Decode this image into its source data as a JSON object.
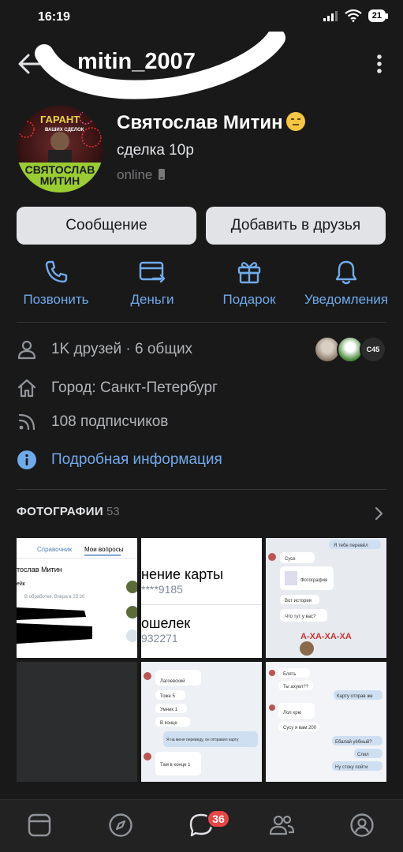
{
  "status_bar": {
    "time": "16:19",
    "battery": "21"
  },
  "header": {
    "username": "mitin_2007"
  },
  "profile": {
    "name": "Святослав Митин",
    "status": "сделка 10р",
    "online": "online",
    "avatar_text_top": "ГАРАНТ",
    "avatar_text_sub": "ВАШИХ СДЕЛОК",
    "avatar_text_name1": "СВЯТОСЛАВ",
    "avatar_text_name2": "МИТИН"
  },
  "buttons": {
    "message": "Сообщение",
    "add_friend": "Добавить в друзья"
  },
  "actions": [
    {
      "label": "Позвонить",
      "icon": "phone-icon"
    },
    {
      "label": "Деньги",
      "icon": "money-transfer-icon"
    },
    {
      "label": "Подарок",
      "icon": "gift-icon"
    },
    {
      "label": "Уведомления",
      "icon": "bell-icon"
    }
  ],
  "info": {
    "friends": "1K друзей · 6 общих",
    "city": "Город: Санкт-Петербург",
    "followers": "108 подписчиков",
    "details": "Подробная информация",
    "mini_avatar_text": "C45"
  },
  "photos": {
    "title": "ФОТОГРАФИИ",
    "count": "53",
    "t1": {
      "tab1": "Справочник",
      "tab2": "Мои вопросы",
      "name": "тослав Митин",
      "sub": "ейк",
      "note": "В обработке, Вчера в 23:20"
    },
    "t2": {
      "line1": "нение карты",
      "line2": "****9185",
      "line3": "ошелек",
      "line4": "932271"
    },
    "t3": {
      "m1": "Я тебе перевёл",
      "m2": "Сусе",
      "m3": "Фотография",
      "m4": "Вот история",
      "m5": "Что тут у вас?",
      "sticker": "А-ХА-ХА-ХА"
    },
    "t5": {
      "m1": "Лагоевский",
      "m2": "Тоже 5",
      "m3": "Умник 1",
      "m4": "В конце",
      "m5": "Я на меня переведу, он отправил карту",
      "m6": "Там в конце 1"
    },
    "t6": {
      "m1": "Блять",
      "m2": "Ты ахуел??",
      "m3": "Карту отправ же",
      "m4": "Лол хрю",
      "m5": "Сусу я вам 200",
      "m6": "Ебалай уёбный?",
      "m7": "Слил",
      "m8": "Ну стоку пойти"
    }
  },
  "nav": {
    "badge": "36"
  },
  "colors": {
    "accent": "#71aaeb",
    "background": "#19191a",
    "badge": "#e64646"
  }
}
